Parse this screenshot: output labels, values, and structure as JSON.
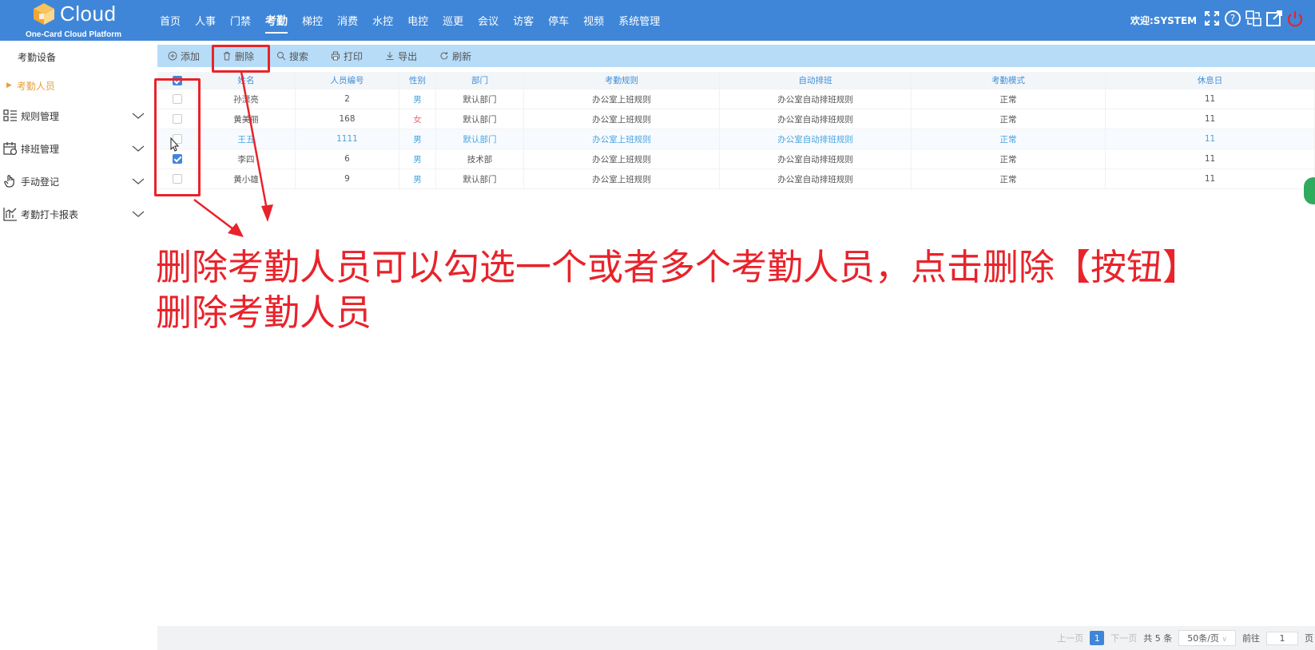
{
  "app": {
    "logo_word": "Cloud",
    "logo_sub": "One-Card Cloud Platform"
  },
  "nav": {
    "items": [
      "首页",
      "人事",
      "门禁",
      "考勤",
      "梯控",
      "消费",
      "水控",
      "电控",
      "巡更",
      "会议",
      "访客",
      "停车",
      "视频",
      "系统管理"
    ],
    "active": "考勤"
  },
  "header": {
    "welcome": "欢迎:SYSTEM",
    "icons": [
      "fullscreen-icon",
      "help-icon",
      "switch-icon",
      "external-link-icon",
      "power-icon"
    ]
  },
  "sidebar": {
    "device": "考勤设备",
    "staff": "考勤人员",
    "groups": [
      {
        "label": "规则管理",
        "icon": "rules-icon"
      },
      {
        "label": "排班管理",
        "icon": "schedule-icon"
      },
      {
        "label": "手动登记",
        "icon": "hand-icon"
      },
      {
        "label": "考勤打卡报表",
        "icon": "report-icon"
      }
    ]
  },
  "toolbar": {
    "add": "添加",
    "delete": "删除",
    "search": "搜索",
    "print": "打印",
    "export": "导出",
    "refresh": "刷新"
  },
  "table": {
    "columns": [
      "姓名",
      "人员编号",
      "性别",
      "部门",
      "考勤规则",
      "自动排班",
      "考勤模式",
      "休息日"
    ],
    "rows": [
      {
        "name": "孙漂亮",
        "id": "2",
        "gender": "男",
        "dept": "默认部门",
        "rule": "办公室上班规则",
        "auto": "办公室自动排班规则",
        "mode": "正常",
        "rest": "11",
        "checked": false
      },
      {
        "name": "黄美丽",
        "id": "168",
        "gender": "女",
        "dept": "默认部门",
        "rule": "办公室上班规则",
        "auto": "办公室自动排班规则",
        "mode": "正常",
        "rest": "11",
        "checked": false
      },
      {
        "name": "王五",
        "id": "1111",
        "gender": "男",
        "dept": "默认部门",
        "rule": "办公室上班规则",
        "auto": "办公室自动排班规则",
        "mode": "正常",
        "rest": "11",
        "checked": false
      },
      {
        "name": "李四",
        "id": "6",
        "gender": "男",
        "dept": "技术部",
        "rule": "办公室上班规则",
        "auto": "办公室自动排班规则",
        "mode": "正常",
        "rest": "11",
        "checked": true
      },
      {
        "name": "黄小雄",
        "id": "9",
        "gender": "男",
        "dept": "默认部门",
        "rule": "办公室上班规则",
        "auto": "办公室自动排班规则",
        "mode": "正常",
        "rest": "11",
        "checked": false
      }
    ]
  },
  "pager": {
    "prev": "上一页",
    "current": "1",
    "next": "下一页",
    "total": "共 5 条",
    "page_size": "50条/页",
    "goto_label": "前往",
    "goto_value": "1",
    "page_suffix": "页"
  },
  "annotation": {
    "line1": "删除考勤人员可以勾选一个或者多个考勤人员，点击删除【按钮】",
    "line2": "删除考勤人员",
    "color": "#e8232b"
  },
  "colors": {
    "topbar": "#3f86d8",
    "toolbar": "#b7dcf8",
    "accent": "#e8a03a"
  }
}
